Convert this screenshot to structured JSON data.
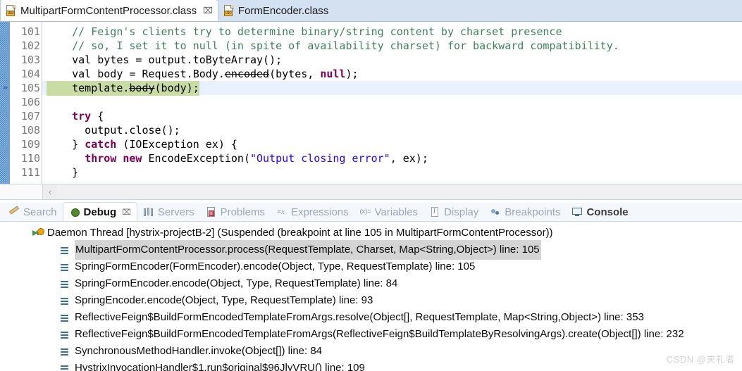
{
  "editor": {
    "tabs": [
      {
        "label": "MultipartFormContentProcessor.class",
        "icon": "class-file-icon",
        "badge": "010",
        "active": true,
        "close": "⌧"
      },
      {
        "label": "FormEncoder.class",
        "icon": "class-file-icon",
        "badge": "010",
        "active": false,
        "close": ""
      }
    ],
    "first_line_number": 101,
    "lines": [
      {
        "num": "101",
        "marker": "",
        "current": false,
        "segments": [
          {
            "text": "    // Feign's clients try to determine binary/string content by charset presence",
            "style": "comment"
          }
        ]
      },
      {
        "num": "102",
        "marker": "",
        "current": false,
        "segments": [
          {
            "text": "    // so, I set it to null (in spite of availability charset) for backward compatibility.",
            "style": "comment"
          }
        ]
      },
      {
        "num": "103",
        "marker": "",
        "current": false,
        "segments": [
          {
            "text": "    val bytes = output.toByteArray();",
            "style": "plain"
          }
        ]
      },
      {
        "num": "104",
        "marker": "",
        "current": false,
        "segments": [
          {
            "text": "    val body = Request.Body.",
            "style": "plain"
          },
          {
            "text": "encoded",
            "style": "deprecated"
          },
          {
            "text": "(bytes, ",
            "style": "plain"
          },
          {
            "text": "null",
            "style": "keyword"
          },
          {
            "text": ");",
            "style": "plain"
          }
        ]
      },
      {
        "num": "105",
        "marker": "»",
        "current": true,
        "highlight": "green",
        "segments": [
          {
            "text": "    template.",
            "style": "plain"
          },
          {
            "text": "body",
            "style": "deprecated"
          },
          {
            "text": "(body);",
            "style": "plain"
          }
        ]
      },
      {
        "num": "106",
        "marker": "",
        "current": false,
        "segments": [
          {
            "text": "",
            "style": "plain"
          }
        ]
      },
      {
        "num": "107",
        "marker": "",
        "current": false,
        "segments": [
          {
            "text": "    ",
            "style": "plain"
          },
          {
            "text": "try",
            "style": "keyword"
          },
          {
            "text": " {",
            "style": "plain"
          }
        ]
      },
      {
        "num": "108",
        "marker": "",
        "current": false,
        "segments": [
          {
            "text": "      output.close();",
            "style": "plain"
          }
        ]
      },
      {
        "num": "109",
        "marker": "",
        "current": false,
        "segments": [
          {
            "text": "    } ",
            "style": "plain"
          },
          {
            "text": "catch",
            "style": "keyword"
          },
          {
            "text": " (IOException ex) {",
            "style": "plain"
          }
        ]
      },
      {
        "num": "110",
        "marker": "",
        "current": false,
        "segments": [
          {
            "text": "      ",
            "style": "plain"
          },
          {
            "text": "throw new",
            "style": "keyword"
          },
          {
            "text": " EncodeException(",
            "style": "plain"
          },
          {
            "text": "\"Output closing error\"",
            "style": "string"
          },
          {
            "text": ", ex);",
            "style": "plain"
          }
        ]
      },
      {
        "num": "111",
        "marker": "",
        "current": false,
        "segments": [
          {
            "text": "    }",
            "style": "plain"
          }
        ]
      }
    ],
    "hscroll_arrow": "‹"
  },
  "debug_view": {
    "tabs": [
      {
        "label": "Search",
        "icon": "search-icon",
        "active": false,
        "close": ""
      },
      {
        "label": "Debug",
        "icon": "bug-icon",
        "active": true,
        "close": "⌧"
      },
      {
        "label": "Servers",
        "icon": "servers-icon",
        "active": false,
        "close": ""
      },
      {
        "label": "Problems",
        "icon": "problems-icon",
        "active": false,
        "close": ""
      },
      {
        "label": "Expressions",
        "icon": "expressions-icon",
        "active": false,
        "close": ""
      },
      {
        "label": "Variables",
        "icon": "variables-icon",
        "active": false,
        "close": ""
      },
      {
        "label": "Display",
        "icon": "display-icon",
        "active": false,
        "close": ""
      },
      {
        "label": "Breakpoints",
        "icon": "breakpoints-icon",
        "active": false,
        "close": ""
      },
      {
        "label": "Console",
        "icon": "console-icon",
        "active": false,
        "close": ""
      }
    ],
    "thread": {
      "twisty": "∨",
      "label": "Daemon Thread [hystrix-projectB-2] (Suspended (breakpoint at line 105 in MultipartFormContentProcessor))"
    },
    "frames": [
      {
        "label": "MultipartFormContentProcessor.process(RequestTemplate, Charset, Map<String,Object>) line: 105",
        "selected": true
      },
      {
        "label": "SpringFormEncoder(FormEncoder).encode(Object, Type, RequestTemplate) line: 105",
        "selected": false
      },
      {
        "label": "SpringFormEncoder.encode(Object, Type, RequestTemplate) line: 84",
        "selected": false
      },
      {
        "label": "SpringEncoder.encode(Object, Type, RequestTemplate) line: 93",
        "selected": false
      },
      {
        "label": "ReflectiveFeign$BuildFormEncodedTemplateFromArgs.resolve(Object[], RequestTemplate, Map<String,Object>) line: 353",
        "selected": false
      },
      {
        "label": "ReflectiveFeign$BuildFormEncodedTemplateFromArgs(ReflectiveFeign$BuildTemplateByResolvingArgs).create(Object[]) line: 232",
        "selected": false
      },
      {
        "label": "SynchronousMethodHandler.invoke(Object[]) line: 84",
        "selected": false
      },
      {
        "label": "HystrixInvocationHandler$1.run$original$96JlyVRU() line: 109",
        "selected": false
      }
    ]
  },
  "watermark": "CSDN @夫礼者",
  "colors": {
    "tabbar_bg": "#d3e1f0",
    "current_line": "#e8f1fd",
    "instruction_pointer": "#c9dca3",
    "comment": "#3f7f5f",
    "keyword": "#7f0055",
    "string": "#2a00ff",
    "selection": "#d4d4d4",
    "diff_bar": "#3f7fc0"
  }
}
